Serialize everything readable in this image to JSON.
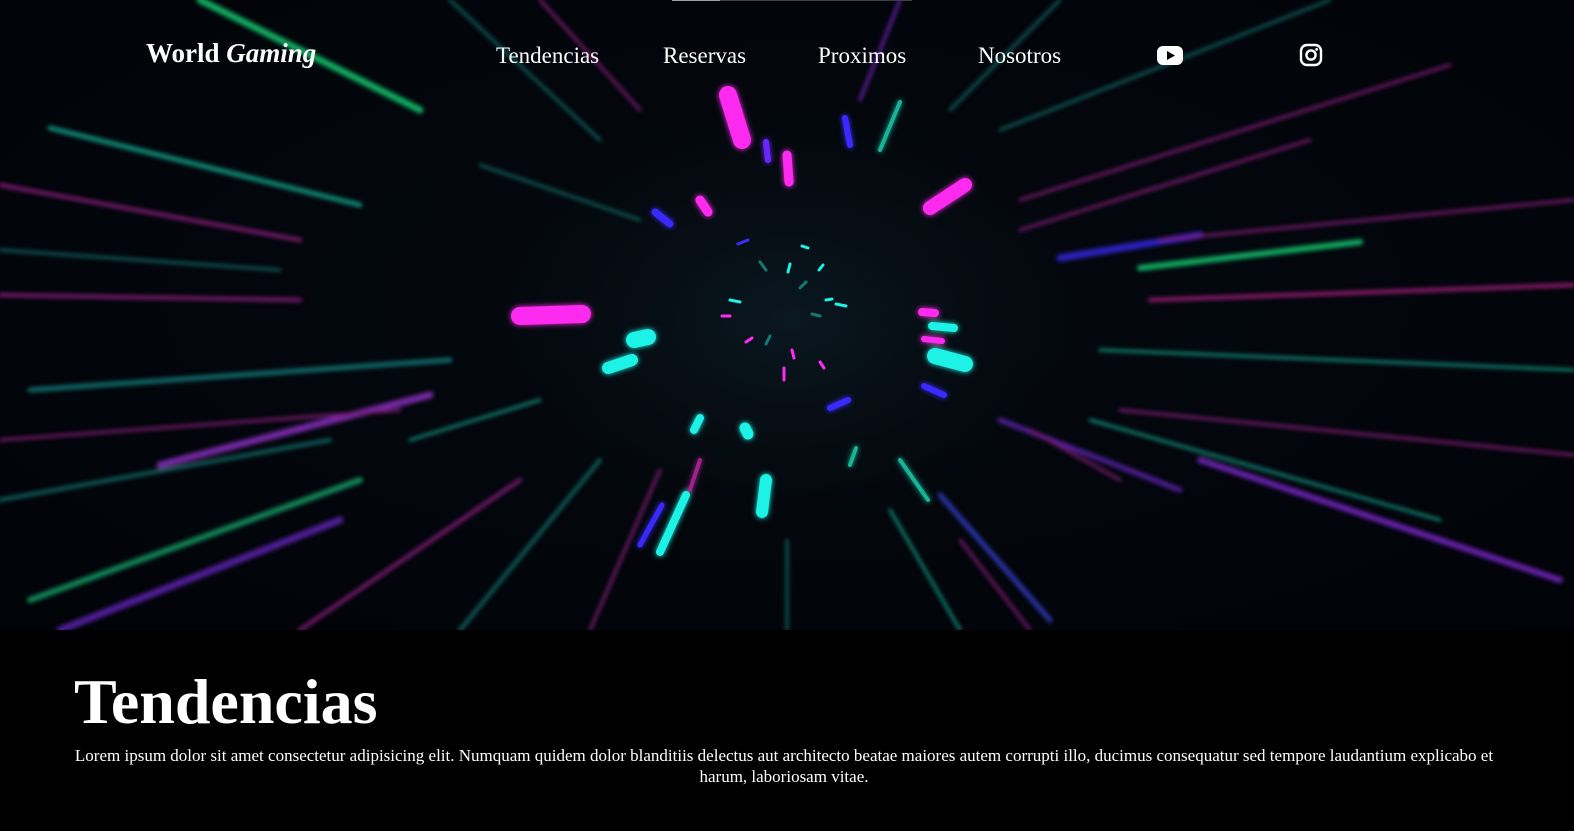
{
  "brand": {
    "part1": "World",
    "part2": "Gaming"
  },
  "nav": {
    "items": [
      {
        "label": "Tendencias"
      },
      {
        "label": "Reservas"
      },
      {
        "label": "Proximos"
      },
      {
        "label": "Nosotros"
      }
    ],
    "social": [
      {
        "icon": "youtube-icon"
      },
      {
        "icon": "instagram-icon"
      }
    ]
  },
  "hero": {
    "background": "neon-warp-speed-tunnel",
    "colors": {
      "magenta": "#ff2cf0",
      "cyan": "#1ef2e6",
      "blue": "#3a2cff",
      "green": "#18e07a",
      "purple": "#8a2be2"
    }
  },
  "section": {
    "title": "Tendencias",
    "text": "Lorem ipsum dolor sit amet consectetur adipisicing elit. Numquam quidem dolor blanditiis delectus aut architecto beatae maiores autem corrupti illo, ducimus consequatur sed tempore laudantium explicabo et harum, laboriosam vitae."
  }
}
